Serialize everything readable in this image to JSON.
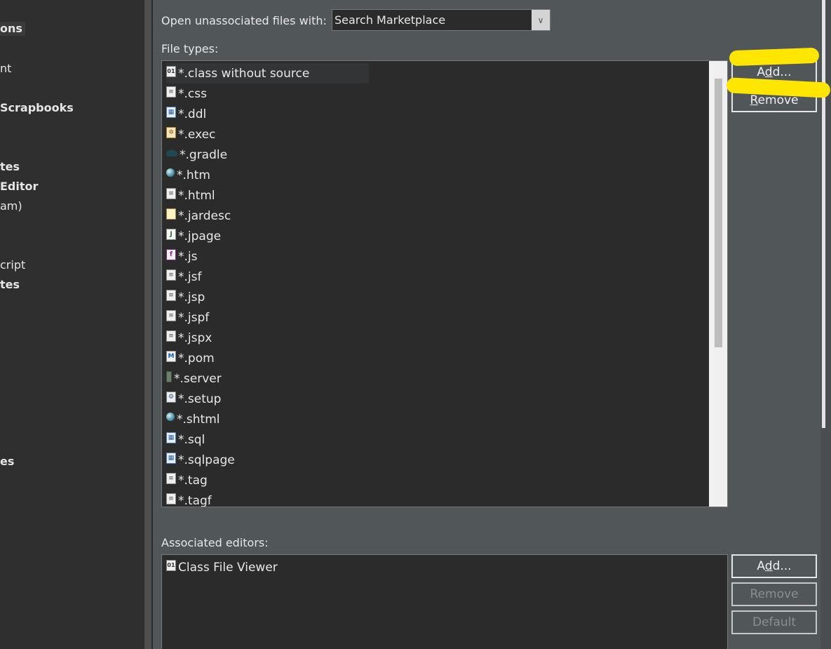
{
  "sidebar": {
    "items": [
      {
        "label": "ons",
        "bold": true,
        "selected": true
      },
      {
        "label": "nt",
        "bold": false
      },
      {
        "label": "Scrapbooks",
        "bold": true
      },
      {
        "label": "tes",
        "bold": true
      },
      {
        "label": "Editor",
        "bold": true
      },
      {
        "label": "am)",
        "bold": false
      },
      {
        "label": "cript",
        "bold": false
      },
      {
        "label": "tes",
        "bold": true
      },
      {
        "label": "es",
        "bold": true
      }
    ]
  },
  "open_with": {
    "label": "Open unassociated files with:",
    "value": "Search Marketplace"
  },
  "file_types": {
    "label": "File types:",
    "items": [
      {
        "label": "*.class without source",
        "icon": "class-file-icon"
      },
      {
        "label": "*.css",
        "icon": "text-file-icon"
      },
      {
        "label": "*.ddl",
        "icon": "database-file-icon"
      },
      {
        "label": "*.exec",
        "icon": "gear-file-icon"
      },
      {
        "label": "*.gradle",
        "icon": "gradle-icon"
      },
      {
        "label": "*.htm",
        "icon": "globe-icon"
      },
      {
        "label": "*.html",
        "icon": "text-file-icon"
      },
      {
        "label": "*.jardesc",
        "icon": "jar-icon"
      },
      {
        "label": "*.jpage",
        "icon": "java-file-icon"
      },
      {
        "label": "*.js",
        "icon": "js-file-icon"
      },
      {
        "label": "*.jsf",
        "icon": "text-file-icon"
      },
      {
        "label": "*.jsp",
        "icon": "text-file-icon"
      },
      {
        "label": "*.jspf",
        "icon": "text-file-icon"
      },
      {
        "label": "*.jspx",
        "icon": "text-file-icon"
      },
      {
        "label": "*.pom",
        "icon": "maven-file-icon"
      },
      {
        "label": "*.server",
        "icon": "server-icon"
      },
      {
        "label": "*.setup",
        "icon": "setup-file-icon"
      },
      {
        "label": "*.shtml",
        "icon": "globe-icon"
      },
      {
        "label": "*.sql",
        "icon": "database-file-icon"
      },
      {
        "label": "*.sqlpage",
        "icon": "database-file-icon"
      },
      {
        "label": "*.tag",
        "icon": "text-file-icon"
      },
      {
        "label": "*.tagf",
        "icon": "text-file-icon"
      }
    ],
    "add_button": {
      "pre": "A",
      "key": "d",
      "post": "d..."
    },
    "remove_button": {
      "pre": "",
      "key": "R",
      "post": "emove"
    }
  },
  "associated_editors": {
    "label": "Associated editors:",
    "items": [
      {
        "label": "Class File Viewer",
        "icon": "class-file-icon"
      }
    ],
    "add_button": {
      "pre": "A",
      "key": "d",
      "post": "d..."
    },
    "remove_button_label": "Remove",
    "default_button_label": "Default"
  },
  "colors": {
    "highlight": "#ffe600",
    "panel_bg": "#515658",
    "list_bg": "#2b2b2b"
  }
}
